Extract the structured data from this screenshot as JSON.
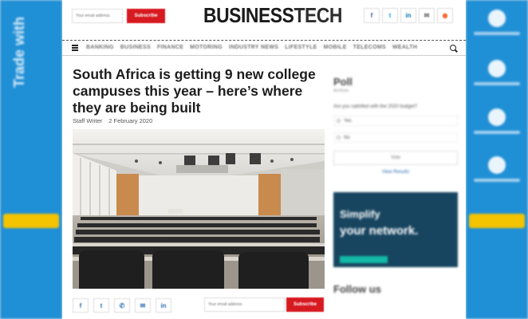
{
  "header": {
    "newsletter_placeholder": "Your email address",
    "newsletter_button": "Subscribe",
    "logo_business": "BUSINESS",
    "logo_tech": "TECH",
    "social": [
      {
        "icon": "facebook-icon",
        "glyph": "f",
        "color": "#3b5998"
      },
      {
        "icon": "twitter-icon",
        "glyph": "t",
        "color": "#1da1f2"
      },
      {
        "icon": "linkedin-icon",
        "glyph": "in",
        "color": "#0077b5"
      },
      {
        "icon": "email-icon",
        "glyph": "✉",
        "color": "#666666"
      },
      {
        "icon": "rss-icon",
        "glyph": "◉",
        "color": "#f26522"
      }
    ]
  },
  "nav": {
    "items": [
      "Banking",
      "Business",
      "Finance",
      "Motoring",
      "Industry News",
      "Lifestyle",
      "Mobile",
      "Telecoms",
      "Wealth"
    ]
  },
  "article": {
    "headline": "South Africa is getting 9 new college campuses this year – here’s where they are being built",
    "author": "Staff Writer",
    "date": "2 February 2020"
  },
  "share": {
    "buttons": [
      {
        "icon": "facebook-icon",
        "glyph": "f"
      },
      {
        "icon": "twitter-icon",
        "glyph": "t"
      },
      {
        "icon": "whatsapp-icon",
        "glyph": "✆"
      },
      {
        "icon": "email-icon",
        "glyph": "✉"
      },
      {
        "icon": "linkedin-icon",
        "glyph": "in"
      }
    ],
    "newsletter_placeholder": "Your email address",
    "newsletter_button": "Subscribe"
  },
  "sidebar": {
    "poll_title": "Poll",
    "poll_subtitle": "Archives",
    "poll_question": "Are you satisfied with the 2020 budget?",
    "options": [
      "Yes",
      "No"
    ],
    "vote_label": "Vote",
    "results_link": "View Results",
    "banner_line1": "Simplify",
    "banner_line2": "your network.",
    "follow_title": "Follow us"
  },
  "side_ads": {
    "left_text": "Trade with",
    "right_items": [
      "Place Calls",
      "Record Calls",
      "Send Fax",
      "Manage Calls"
    ]
  },
  "colors": {
    "accent_red": "#d71920",
    "ad_blue": "#1f8fd6",
    "link_blue": "#2b6cb0"
  }
}
